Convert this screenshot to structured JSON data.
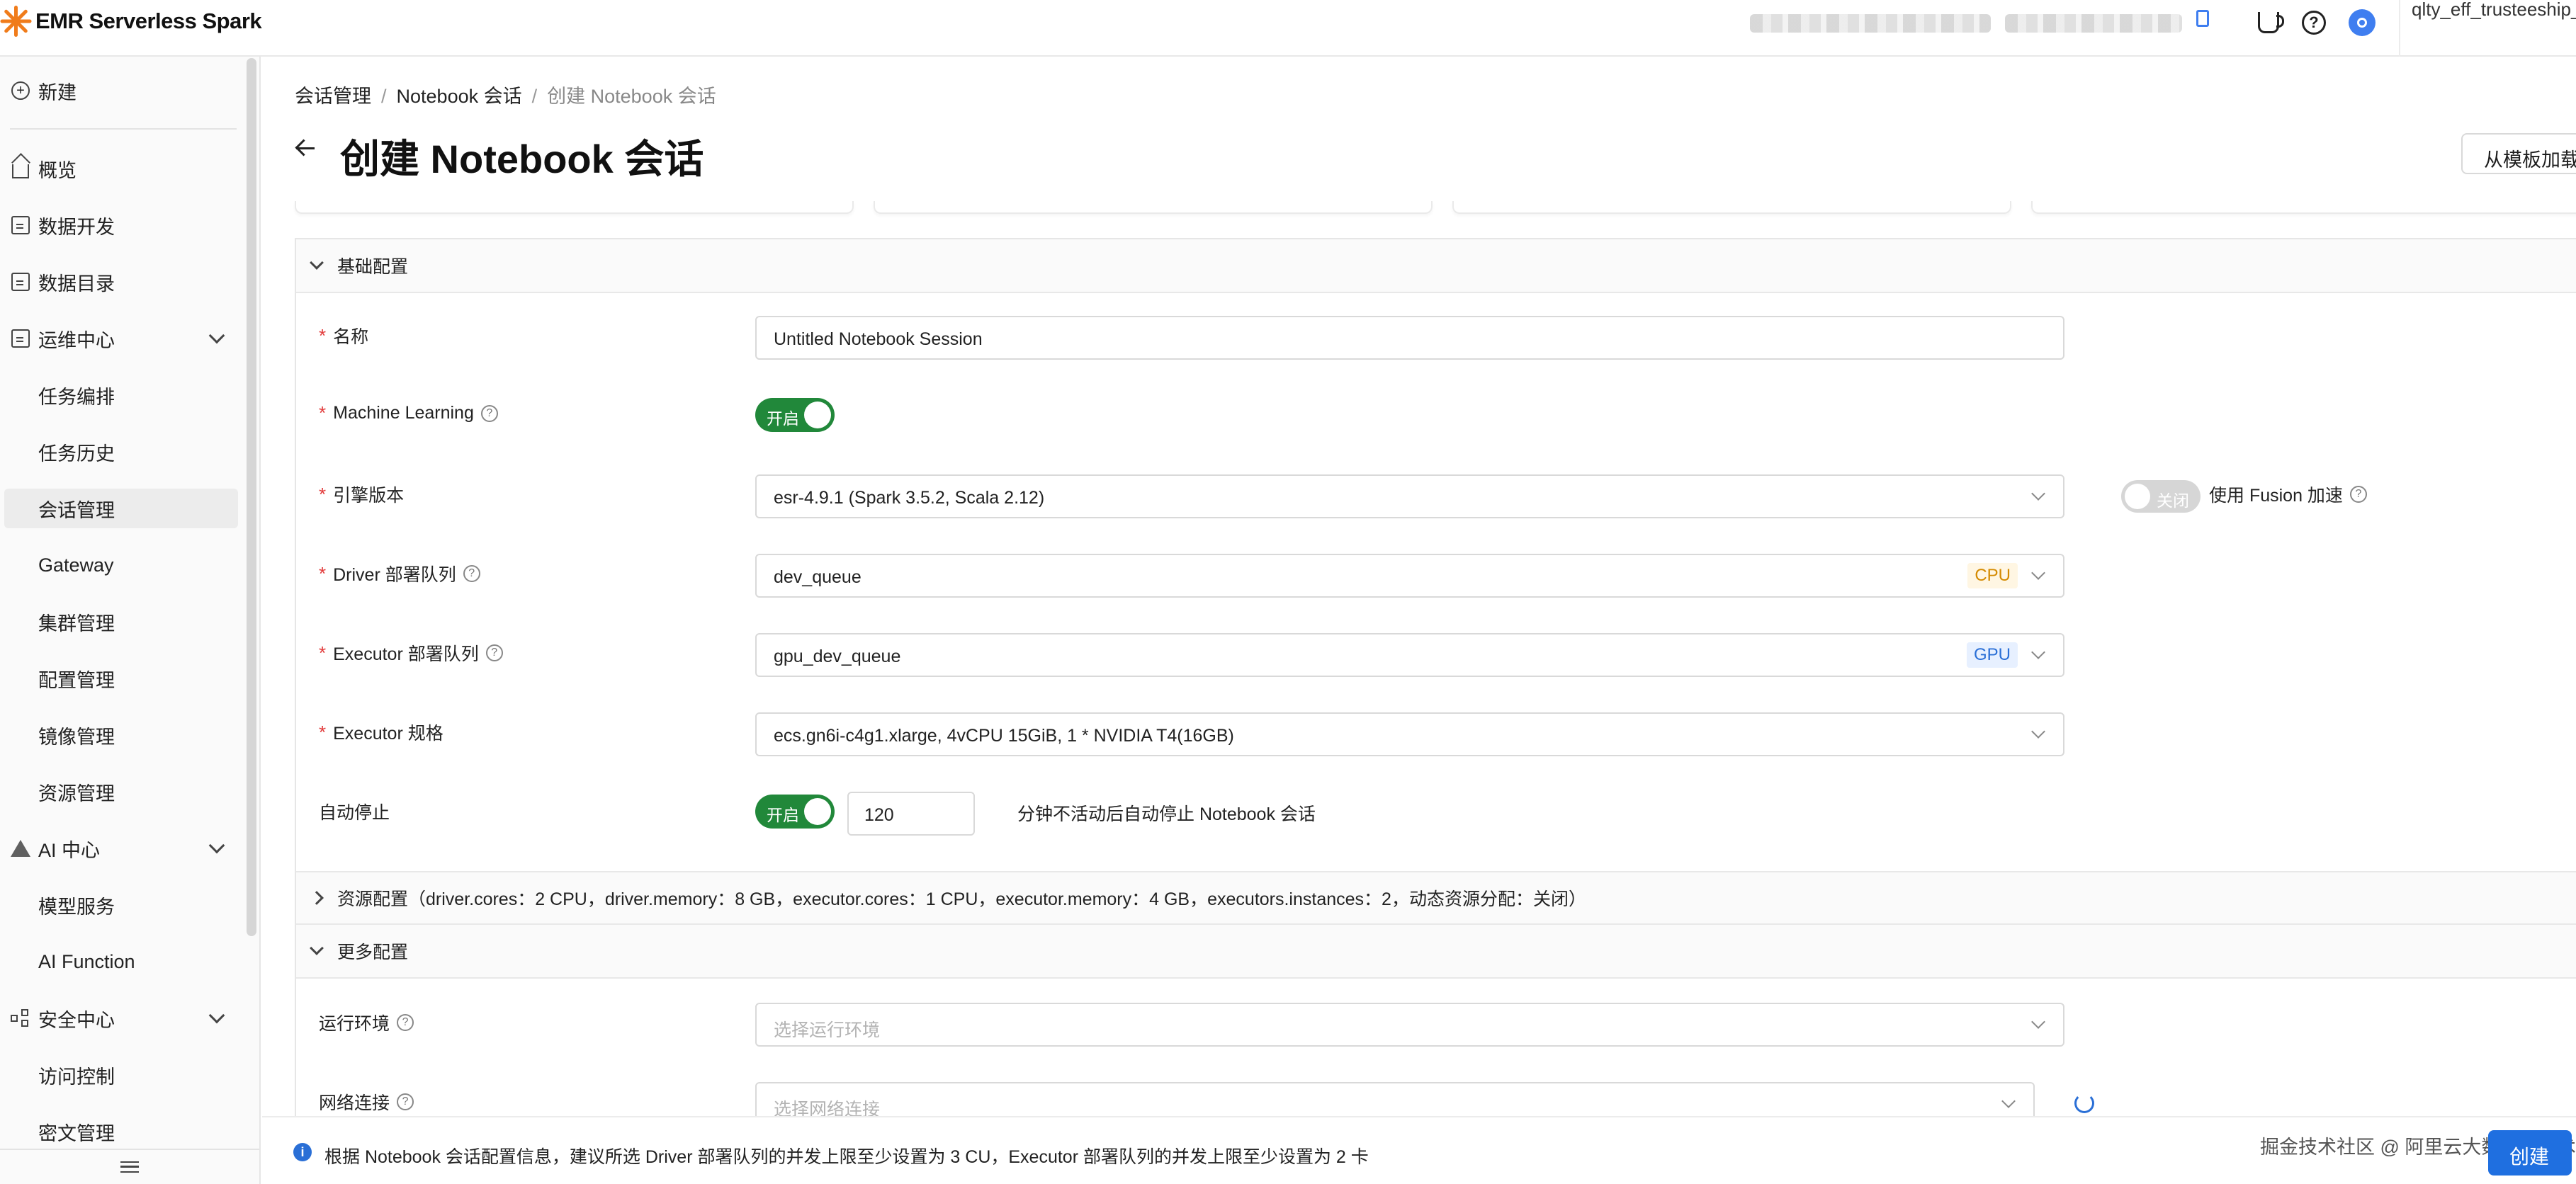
{
  "app": {
    "name": "EMR Serverless Spark",
    "user": "qlty_eff_trusteeship_"
  },
  "sidebar": {
    "new_label": "新建",
    "items": [
      {
        "label": "概览"
      },
      {
        "label": "数据开发"
      },
      {
        "label": "数据目录"
      },
      {
        "label": "运维中心"
      },
      {
        "label": "任务编排"
      },
      {
        "label": "任务历史"
      },
      {
        "label": "会话管理"
      },
      {
        "label": "Gateway"
      },
      {
        "label": "集群管理"
      },
      {
        "label": "配置管理"
      },
      {
        "label": "镜像管理"
      },
      {
        "label": "资源管理"
      },
      {
        "label": "AI 中心"
      },
      {
        "label": "模型服务"
      },
      {
        "label": "AI Function"
      },
      {
        "label": "安全中心"
      },
      {
        "label": "访问控制"
      },
      {
        "label": "密文管理"
      }
    ]
  },
  "breadcrumb": {
    "items": [
      "会话管理",
      "Notebook 会话",
      "创建 Notebook 会话"
    ],
    "separator": "/"
  },
  "page": {
    "title": "创建 Notebook 会话",
    "template_button": "从模板加载"
  },
  "sections": {
    "basic": "基础配置",
    "resource": "资源配置（driver.cores：2 CPU，driver.memory：8 GB，executor.cores：1 CPU，executor.memory：4 GB，executors.instances：2，动态资源分配：关闭）",
    "more": "更多配置"
  },
  "form": {
    "name": {
      "label": "名称",
      "value": "Untitled Notebook Session"
    },
    "ml": {
      "label": "Machine Learning",
      "toggle": "开启"
    },
    "engine": {
      "label": "引擎版本",
      "value": "esr-4.9.1 (Spark 3.5.2, Scala 2.12)",
      "fusion_toggle": "关闭",
      "fusion_label": "使用 Fusion 加速"
    },
    "driver_queue": {
      "label": "Driver 部署队列",
      "value": "dev_queue",
      "tag": "CPU"
    },
    "executor_queue": {
      "label": "Executor 部署队列",
      "value": "gpu_dev_queue",
      "tag": "GPU"
    },
    "executor_spec": {
      "label": "Executor 规格",
      "value": "ecs.gn6i-c4g1.xlarge, 4vCPU 15GiB, 1 * NVIDIA T4(16GB)"
    },
    "auto_stop": {
      "label": "自动停止",
      "toggle": "开启",
      "minutes": "120",
      "suffix": "分钟不活动后自动停止 Notebook 会话"
    },
    "runtime_env": {
      "label": "运行环境",
      "placeholder": "选择运行环境"
    },
    "network": {
      "label": "网络连接",
      "placeholder": "选择网络连接"
    }
  },
  "footer": {
    "info": "根据 Notebook 会话配置信息，建议所选 Driver 部署队列的并发上限至少设置为 3 CU，Executor 部署队列的并发上限至少设置为 2 卡",
    "create_button": "创建",
    "watermark": "掘金技术社区 @ 阿里云大数据AI技术"
  },
  "colors": {
    "toggle_on": "#21883a",
    "primary": "#1f6fe0",
    "required": "#e23b3b",
    "cpu_tag": "#d48a00",
    "gpu_tag": "#2a6fd6"
  }
}
